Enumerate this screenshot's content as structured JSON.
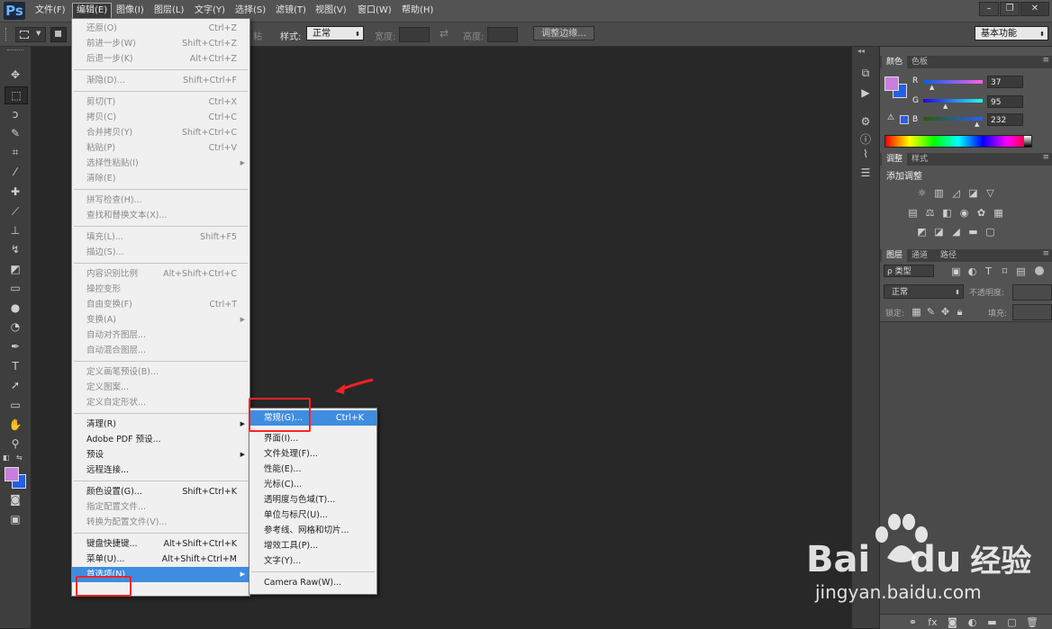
{
  "app": {
    "logo": "Ps"
  },
  "menubar": {
    "items": [
      "文件(F)",
      "编辑(E)",
      "图像(I)",
      "图层(L)",
      "文字(Y)",
      "选择(S)",
      "滤镜(T)",
      "视图(V)",
      "窗口(W)",
      "帮助(H)"
    ],
    "window_controls": [
      "–",
      "❐",
      "✕"
    ]
  },
  "options": {
    "feather_tail": "粘",
    "style_label": "样式:",
    "style_value": "正常",
    "width_label": "宽度:",
    "height_label": "高度:",
    "refine_label": "调整边缘...",
    "workspace": "基本功能"
  },
  "edit_menu": {
    "items": [
      {
        "label": "还原(O)",
        "shortcut": "Ctrl+Z",
        "disabled": true
      },
      {
        "label": "前进一步(W)",
        "shortcut": "Shift+Ctrl+Z",
        "disabled": true
      },
      {
        "label": "后退一步(K)",
        "shortcut": "Alt+Ctrl+Z",
        "disabled": true
      },
      {
        "label": "渐隐(D)...",
        "shortcut": "Shift+Ctrl+F",
        "disabled": true
      },
      {
        "label": "剪切(T)",
        "shortcut": "Ctrl+X",
        "disabled": true
      },
      {
        "label": "拷贝(C)",
        "shortcut": "Ctrl+C",
        "disabled": true
      },
      {
        "label": "合并拷贝(Y)",
        "shortcut": "Shift+Ctrl+C",
        "disabled": true
      },
      {
        "label": "粘贴(P)",
        "shortcut": "Ctrl+V",
        "disabled": true
      },
      {
        "label": "选择性粘贴(I)",
        "shortcut": "",
        "disabled": true,
        "submenu": true
      },
      {
        "label": "清除(E)",
        "shortcut": "",
        "disabled": true
      },
      {
        "label": "拼写检查(H)...",
        "shortcut": "",
        "disabled": true
      },
      {
        "label": "查找和替换文本(X)...",
        "shortcut": "",
        "disabled": true
      },
      {
        "label": "填充(L)...",
        "shortcut": "Shift+F5",
        "disabled": true
      },
      {
        "label": "描边(S)...",
        "shortcut": "",
        "disabled": true
      },
      {
        "label": "内容识别比例",
        "shortcut": "Alt+Shift+Ctrl+C",
        "disabled": true
      },
      {
        "label": "操控变形",
        "shortcut": "",
        "disabled": true
      },
      {
        "label": "自由变换(F)",
        "shortcut": "Ctrl+T",
        "disabled": true
      },
      {
        "label": "变换(A)",
        "shortcut": "",
        "disabled": true,
        "submenu": true
      },
      {
        "label": "自动对齐图层...",
        "shortcut": "",
        "disabled": true
      },
      {
        "label": "自动混合图层...",
        "shortcut": "",
        "disabled": true
      },
      {
        "label": "定义画笔预设(B)...",
        "shortcut": "",
        "disabled": true
      },
      {
        "label": "定义图案...",
        "shortcut": "",
        "disabled": true
      },
      {
        "label": "定义自定形状...",
        "shortcut": "",
        "disabled": true
      },
      {
        "label": "清理(R)",
        "shortcut": "",
        "disabled": false,
        "submenu": true
      },
      {
        "label": "Adobe PDF 预设...",
        "shortcut": "",
        "disabled": false
      },
      {
        "label": "预设",
        "shortcut": "",
        "disabled": false,
        "submenu": true
      },
      {
        "label": "远程连接...",
        "shortcut": "",
        "disabled": false
      },
      {
        "label": "颜色设置(G)...",
        "shortcut": "Shift+Ctrl+K",
        "disabled": false
      },
      {
        "label": "指定配置文件...",
        "shortcut": "",
        "disabled": true
      },
      {
        "label": "转换为配置文件(V)...",
        "shortcut": "",
        "disabled": true
      },
      {
        "label": "键盘快捷键...",
        "shortcut": "Alt+Shift+Ctrl+K",
        "disabled": false
      },
      {
        "label": "菜单(U)...",
        "shortcut": "Alt+Shift+Ctrl+M",
        "disabled": false
      },
      {
        "label": "首选项(N)",
        "shortcut": "",
        "disabled": false,
        "submenu": true,
        "highlighted": true
      }
    ]
  },
  "prefs_menu": {
    "items": [
      {
        "label": "常规(G)...",
        "shortcut": "Ctrl+K",
        "highlighted": true
      },
      {
        "label": "界面(I)...",
        "shortcut": ""
      },
      {
        "label": "文件处理(F)...",
        "shortcut": ""
      },
      {
        "label": "性能(E)...",
        "shortcut": ""
      },
      {
        "label": "光标(C)...",
        "shortcut": ""
      },
      {
        "label": "透明度与色域(T)...",
        "shortcut": ""
      },
      {
        "label": "单位与标尺(U)...",
        "shortcut": ""
      },
      {
        "label": "参考线、网格和切片...",
        "shortcut": ""
      },
      {
        "label": "增效工具(P)...",
        "shortcut": ""
      },
      {
        "label": "文字(Y)...",
        "shortcut": ""
      },
      {
        "label": "Camera Raw(W)...",
        "shortcut": ""
      }
    ]
  },
  "color_panel": {
    "tabs": [
      "颜色",
      "色板"
    ],
    "channels": [
      {
        "name": "R",
        "value": "37",
        "pos": 0.145
      },
      {
        "name": "G",
        "value": "95",
        "pos": 0.373
      },
      {
        "name": "B",
        "value": "232",
        "pos": 0.91
      }
    ],
    "fg_color": "#c97ddf",
    "bg_color": "#255fe8"
  },
  "adjust_panel": {
    "tabs": [
      "调整",
      "样式"
    ],
    "title": "添加调整"
  },
  "layers_panel": {
    "tabs": [
      "图层",
      "通道",
      "路径"
    ],
    "filter_label": "ρ 类型",
    "blend_mode": "正常",
    "opacity_label": "不透明度:",
    "lock_label": "锁定:",
    "fill_label": "填充:"
  },
  "watermark": {
    "brand": "Bai",
    "brand2": "du",
    "brand_cn": "经验",
    "url": "jingyan.baidu.com"
  }
}
